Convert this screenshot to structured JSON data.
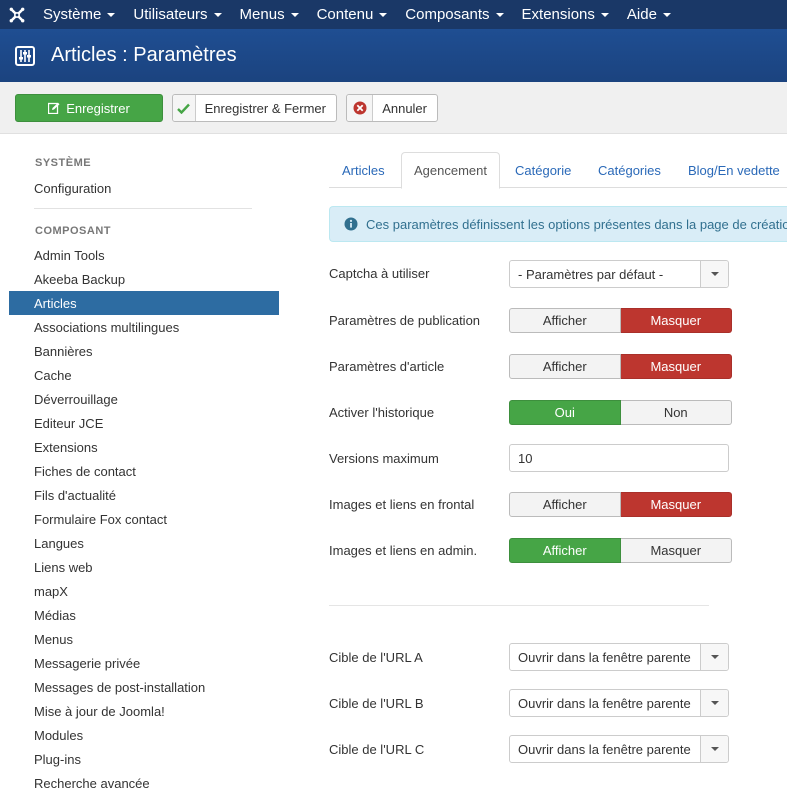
{
  "nav": {
    "items": [
      {
        "label": "Système"
      },
      {
        "label": "Utilisateurs"
      },
      {
        "label": "Menus"
      },
      {
        "label": "Contenu"
      },
      {
        "label": "Composants"
      },
      {
        "label": "Extensions"
      },
      {
        "label": "Aide"
      }
    ]
  },
  "header": {
    "title": "Articles : Paramètres"
  },
  "toolbar": {
    "save_label": "Enregistrer",
    "save_close_label": "Enregistrer & Fermer",
    "cancel_label": "Annuler"
  },
  "sidebar": {
    "system_heading": "SYSTÈME",
    "configuration": "Configuration",
    "component_heading": "COMPOSANT",
    "items": [
      "Admin Tools",
      "Akeeba Backup",
      "Articles",
      "Associations multilingues",
      "Bannières",
      "Cache",
      "Déverrouillage",
      "Editeur JCE",
      "Extensions",
      "Fiches de contact",
      "Fils d'actualité",
      "Formulaire Fox contact",
      "Langues",
      "Liens web",
      "mapX",
      "Médias",
      "Menus",
      "Messagerie privée",
      "Messages de post-installation",
      "Mise à jour de Joomla!",
      "Modules",
      "Plug-ins",
      "Recherche avancée"
    ],
    "active_item": "Articles"
  },
  "tabs": [
    {
      "label": "Articles"
    },
    {
      "label": "Agencement"
    },
    {
      "label": "Catégorie"
    },
    {
      "label": "Catégories"
    },
    {
      "label": "Blog/En vedette"
    }
  ],
  "alert": {
    "text": "Ces paramètres définissent les options présentes dans la page de création"
  },
  "form": {
    "captcha": {
      "label": "Captcha à utiliser",
      "value": "- Paramètres par défaut -"
    },
    "publication": {
      "label": "Paramètres de publication",
      "options": [
        "Afficher",
        "Masquer"
      ]
    },
    "article_params": {
      "label": "Paramètres d'article",
      "options": [
        "Afficher",
        "Masquer"
      ]
    },
    "history": {
      "label": "Activer l'historique",
      "options": [
        "Oui",
        "Non"
      ]
    },
    "max_versions": {
      "label": "Versions maximum",
      "value": "10"
    },
    "images_frontal": {
      "label": "Images et liens en frontal",
      "options": [
        "Afficher",
        "Masquer"
      ]
    },
    "images_admin": {
      "label": "Images et liens en admin.",
      "options": [
        "Afficher",
        "Masquer"
      ]
    },
    "url_a": {
      "label": "Cible de l'URL A",
      "value": "Ouvrir dans la fenêtre parente"
    },
    "url_b": {
      "label": "Cible de l'URL B",
      "value": "Ouvrir dans la fenêtre parente"
    },
    "url_c": {
      "label": "Cible de l'URL C",
      "value": "Ouvrir dans la fenêtre parente"
    }
  },
  "colors": {
    "navbar": "#1a3867",
    "header": "#1f4a8a",
    "success": "#46a546",
    "danger": "#bd362f",
    "active": "#2d6ca2",
    "link": "#2a69b8"
  }
}
